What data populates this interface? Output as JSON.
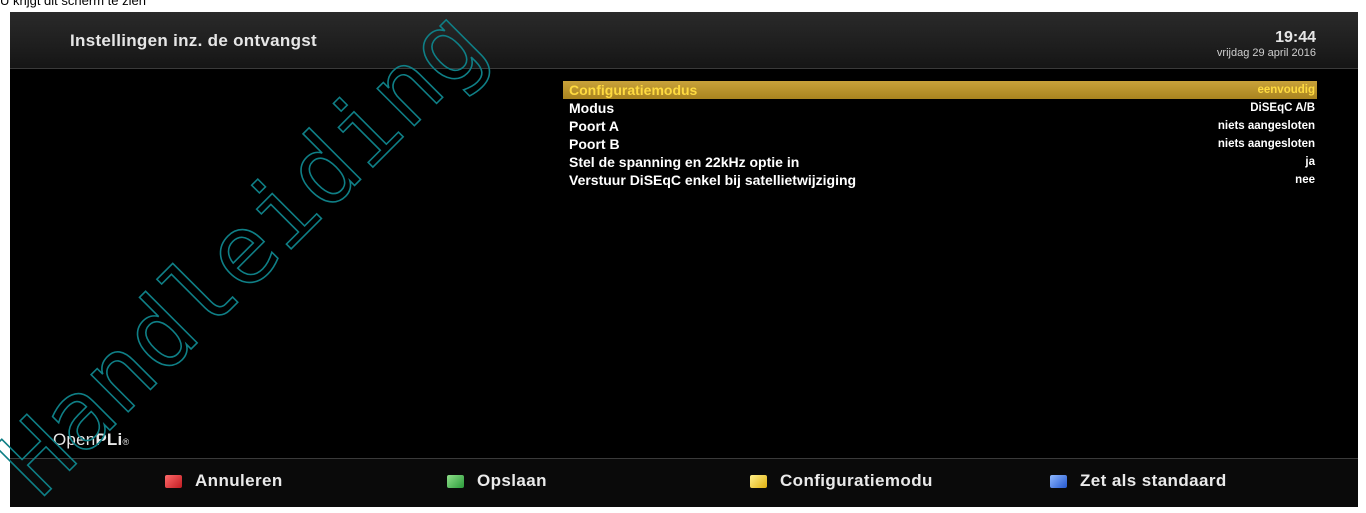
{
  "caption": "U krijgt dit scherm te zien",
  "header": {
    "title": "Instellingen inz. de ontvangst",
    "time": "19:44",
    "date": "vrijdag 29 april 2016"
  },
  "settings": [
    {
      "label": "Configuratiemodus",
      "value": "eenvoudig",
      "selected": true
    },
    {
      "label": "Modus",
      "value": "DiSEqC A/B"
    },
    {
      "label": "Poort A",
      "value": "niets aangesloten"
    },
    {
      "label": "Poort B",
      "value": "niets aangesloten"
    },
    {
      "label": "Stel de spanning en 22kHz optie in",
      "value": "ja"
    },
    {
      "label": "Verstuur DiSEqC enkel bij satellietwijziging",
      "value": "nee"
    }
  ],
  "brand": {
    "part1": "Open",
    "part2": "PLi",
    "mark": "®"
  },
  "footer": {
    "red": "Annuleren",
    "green": "Opslaan",
    "yellow": "Configuratiemodu",
    "blue": "Zet als standaard"
  },
  "colors": {
    "red": "#d2262b",
    "green": "#38b34a",
    "yellow": "#f1c61c",
    "blue": "#2f6ae0",
    "selection": "#b8912a",
    "watermark": "#0f7f86"
  },
  "watermark": "Handleiding OpenPLi"
}
